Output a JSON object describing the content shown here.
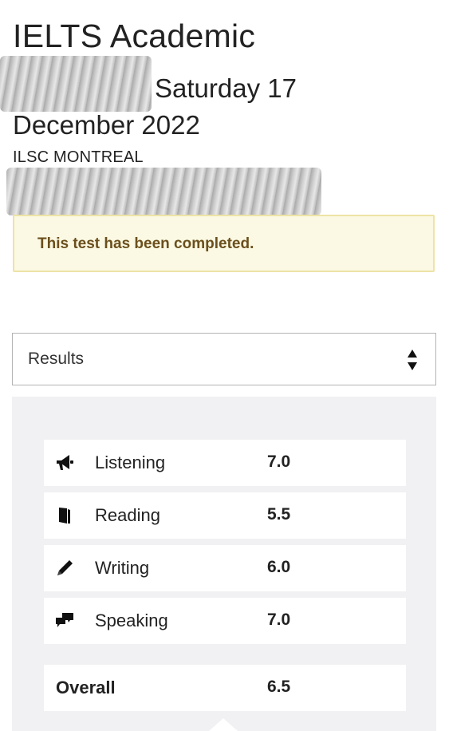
{
  "page": {
    "title": "IELTS Academic",
    "date": "Saturday 17 December 2022",
    "venue": "ILSC MONTREAL"
  },
  "alert": {
    "message": "This test has been completed."
  },
  "results_select": {
    "selected": "Results"
  },
  "scores": [
    {
      "label": "Listening",
      "score": "7.0",
      "icon": "megaphone-icon"
    },
    {
      "label": "Reading",
      "score": "5.5",
      "icon": "book-icon"
    },
    {
      "label": "Writing",
      "score": "6.0",
      "icon": "pencil-icon"
    },
    {
      "label": "Speaking",
      "score": "7.0",
      "icon": "speech-bubbles-icon"
    }
  ],
  "overall": {
    "label": "Overall",
    "score": "6.5"
  },
  "colors": {
    "alert_background": "#fbf9e3",
    "alert_border": "#eee3a6",
    "alert_text": "#6b4f1c",
    "panel_background": "#f1f1f3"
  }
}
